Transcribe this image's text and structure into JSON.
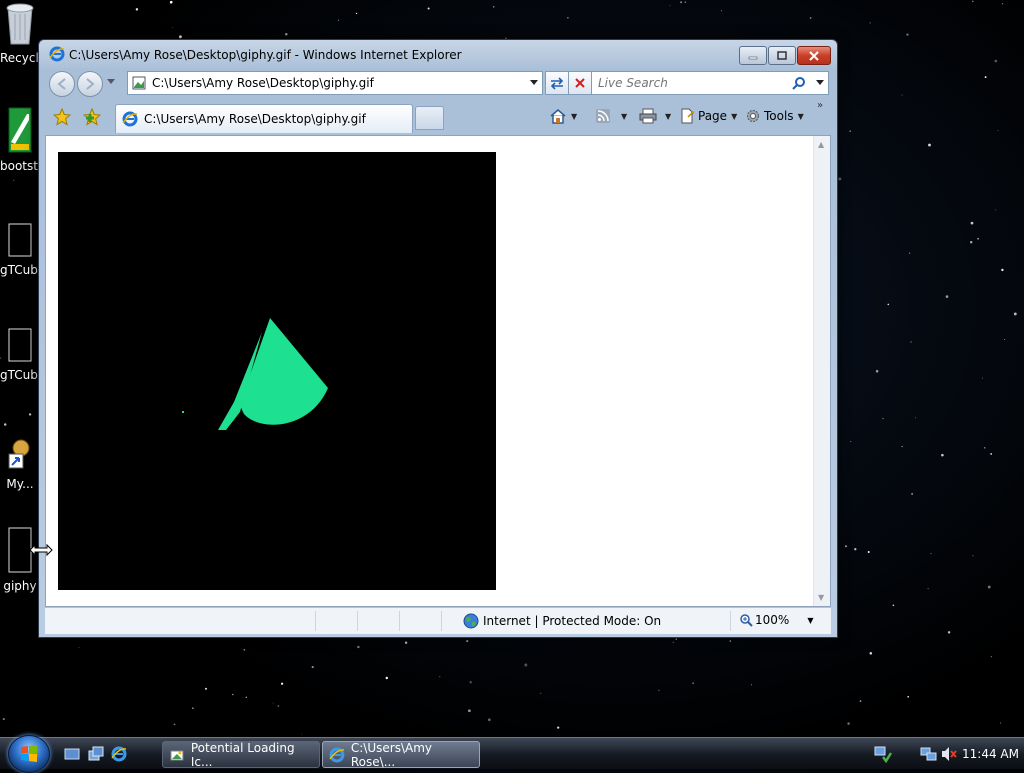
{
  "desktop": {
    "icons": [
      {
        "label": "Recycle Bin",
        "icon": "recycle-bin-icon"
      },
      {
        "label": "bootstrap",
        "icon": "bootstrap-icon"
      },
      {
        "label": "gTCube",
        "icon": "file-thumbnail-icon"
      },
      {
        "label": "gTCube",
        "icon": "file-thumbnail-icon"
      },
      {
        "label": "My...",
        "icon": "shortcut-icon"
      },
      {
        "label": "giphy",
        "icon": "gif-file-icon"
      }
    ]
  },
  "window": {
    "title": "C:\\Users\\Amy Rose\\Desktop\\giphy.gif - Windows Internet Explorer",
    "address": "C:\\Users\\Amy Rose\\Desktop\\giphy.gif",
    "search_placeholder": "Live Search",
    "tab_label": "C:\\Users\\Amy Rose\\Desktop\\giphy.gif",
    "commands": {
      "page": "Page",
      "tools": "Tools"
    },
    "status": {
      "zone": "Internet | Protected Mode: On",
      "zoom": "100%"
    },
    "image": {
      "background": "#000000",
      "shape_color": "#1de090"
    }
  },
  "taskbar": {
    "buttons": [
      {
        "label": "Potential Loading Ic...",
        "icon": "paint-icon",
        "active": false
      },
      {
        "label": "C:\\Users\\Amy Rose\\...",
        "icon": "ie-icon",
        "active": true
      }
    ],
    "clock": "11:44 AM"
  }
}
